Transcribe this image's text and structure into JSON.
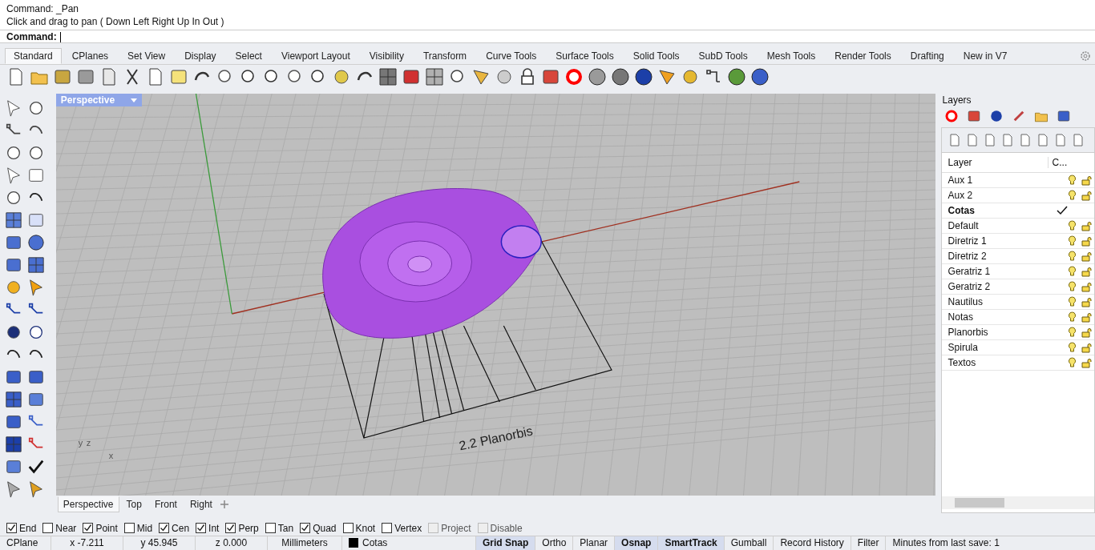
{
  "command_history": [
    "Command: _Pan",
    "Click and drag to pan ( Down  Left  Right  Up  In  Out )"
  ],
  "command_prompt": {
    "label": "Command:"
  },
  "toolbar_tabs": [
    {
      "label": "Standard",
      "selected": true
    },
    {
      "label": "CPlanes",
      "selected": false
    },
    {
      "label": "Set View",
      "selected": false
    },
    {
      "label": "Display",
      "selected": false
    },
    {
      "label": "Select",
      "selected": false
    },
    {
      "label": "Viewport Layout",
      "selected": false
    },
    {
      "label": "Visibility",
      "selected": false
    },
    {
      "label": "Transform",
      "selected": false
    },
    {
      "label": "Curve Tools",
      "selected": false
    },
    {
      "label": "Surface Tools",
      "selected": false
    },
    {
      "label": "Solid Tools",
      "selected": false
    },
    {
      "label": "SubD Tools",
      "selected": false
    },
    {
      "label": "Mesh Tools",
      "selected": false
    },
    {
      "label": "Render Tools",
      "selected": false
    },
    {
      "label": "Drafting",
      "selected": false
    },
    {
      "label": "New in V7",
      "selected": false
    }
  ],
  "viewport": {
    "title": "Perspective",
    "annotation": "2.2 Planorbis",
    "axis_labels": [
      "y",
      "z",
      "x"
    ]
  },
  "viewport_tabs": [
    {
      "label": "Perspective",
      "selected": true
    },
    {
      "label": "Top",
      "selected": false
    },
    {
      "label": "Front",
      "selected": false
    },
    {
      "label": "Right",
      "selected": false
    }
  ],
  "layers_panel": {
    "title": "Layers",
    "columns": [
      "Layer",
      "C..."
    ],
    "layers": [
      {
        "name": "Aux 1",
        "current": false
      },
      {
        "name": "Aux 2",
        "current": false
      },
      {
        "name": "Cotas",
        "current": true
      },
      {
        "name": "Default",
        "current": false
      },
      {
        "name": "Diretriz 1",
        "current": false
      },
      {
        "name": "Diretriz 2",
        "current": false
      },
      {
        "name": "Geratriz 1",
        "current": false
      },
      {
        "name": "Geratriz 2",
        "current": false
      },
      {
        "name": "Nautilus",
        "current": false
      },
      {
        "name": "Notas",
        "current": false
      },
      {
        "name": "Planorbis",
        "current": false
      },
      {
        "name": "Spirula",
        "current": false
      },
      {
        "name": "Textos",
        "current": false
      }
    ]
  },
  "osnaps": [
    {
      "label": "End",
      "checked": true,
      "disabled": false
    },
    {
      "label": "Near",
      "checked": false,
      "disabled": false
    },
    {
      "label": "Point",
      "checked": true,
      "disabled": false
    },
    {
      "label": "Mid",
      "checked": false,
      "disabled": false
    },
    {
      "label": "Cen",
      "checked": true,
      "disabled": false
    },
    {
      "label": "Int",
      "checked": true,
      "disabled": false
    },
    {
      "label": "Perp",
      "checked": true,
      "disabled": false
    },
    {
      "label": "Tan",
      "checked": false,
      "disabled": false
    },
    {
      "label": "Quad",
      "checked": true,
      "disabled": false
    },
    {
      "label": "Knot",
      "checked": false,
      "disabled": false
    },
    {
      "label": "Vertex",
      "checked": false,
      "disabled": false
    },
    {
      "label": "Project",
      "checked": false,
      "disabled": true
    },
    {
      "label": "Disable",
      "checked": false,
      "disabled": true
    }
  ],
  "status_bar": {
    "cplane": "CPlane",
    "coords": [
      "x -7.211",
      "y 45.945",
      "z 0.000"
    ],
    "units": "Millimeters",
    "layer": "Cotas",
    "toggles": [
      {
        "label": "Grid Snap",
        "on": true
      },
      {
        "label": "Ortho",
        "on": false
      },
      {
        "label": "Planar",
        "on": false
      },
      {
        "label": "Osnap",
        "on": true
      },
      {
        "label": "SmartTrack",
        "on": true
      },
      {
        "label": "Gumball",
        "on": false
      },
      {
        "label": "Record History",
        "on": false
      },
      {
        "label": "Filter",
        "on": false
      }
    ],
    "save_info": "Minutes from last save: 1"
  }
}
